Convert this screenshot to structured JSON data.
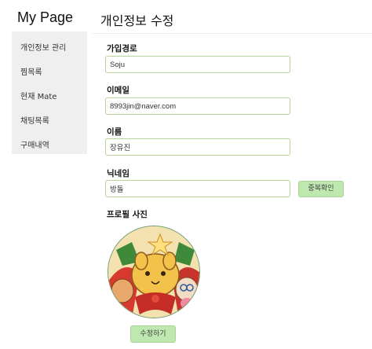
{
  "app": {
    "brand": "My Page",
    "page_title": "개인정보 수정"
  },
  "sidebar": {
    "items": [
      {
        "label": "개인정보 관리"
      },
      {
        "label": "찜목록"
      },
      {
        "label": "현재 Mate"
      },
      {
        "label": "채팅목록"
      },
      {
        "label": "구매내역"
      }
    ]
  },
  "form": {
    "signup_route": {
      "label": "가입경로",
      "value": "Soju"
    },
    "email": {
      "label": "이메일",
      "value": "8993jin@naver.com"
    },
    "name": {
      "label": "이름",
      "value": "장유진"
    },
    "nickname": {
      "label": "닉네임",
      "value": "방돌",
      "check_button": "중복확인"
    },
    "profile_photo": {
      "label": "프로필 사진"
    },
    "submit_label": "수정하기"
  },
  "colors": {
    "input_border": "#b9d39a",
    "button_bg": "#bfe7b0",
    "sidebar_bg": "#efefef"
  }
}
